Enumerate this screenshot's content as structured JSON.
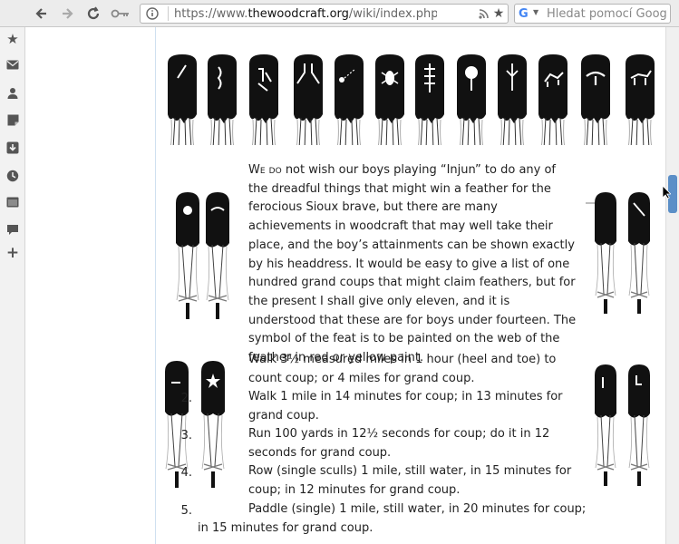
{
  "browser": {
    "url_prefix": "https://www.",
    "url_domain": "thewoodcraft.org",
    "url_suffix": "/wiki/index.php?title=Ladie",
    "search_placeholder": "Hledat pomocí Googl"
  },
  "article": {
    "intro_smallcaps": "We do",
    "intro_rest": " not wish our boys playing “Injun” to do any of the dreadful things that might win a feather for the ferocious Sioux brave, but there are many achievements in woodcraft that may well take their place, and the boy’s attainments can be shown exactly by his headdress. It would be easy to give a list of one hundred grand coups that might claim feathers, but for the present I shall give only eleven, and it is understood that these are for boys under fourteen. The symbol of the feat is to be painted on the web of the feather in red or yellow paint.",
    "items": [
      {
        "num": "",
        "line1": "Walk 3½ measured miles in 1 hour (heel and toe) to",
        "line2": "count coup; or 4 miles for grand coup."
      },
      {
        "num": "2.",
        "line1": "Walk 1 mile in 14 minutes for coup; in 13 minutes for",
        "line2": "grand coup."
      },
      {
        "num": "3.",
        "line1": "Run 100 yards in 12½ seconds for coup; do it in 12",
        "line2": "seconds for grand coup."
      },
      {
        "num": "4.",
        "line1": "Row (single sculls) 1 mile, still water, in 15 minutes for",
        "line2": "coup; in 12 minutes for grand coup."
      },
      {
        "num": "5.",
        "line1": "Paddle (single) 1 mile, still water, in 20 minutes for coup;",
        "line2": "in 15 minutes for grand coup."
      }
    ]
  },
  "icons": {
    "back": "arrow-left-icon",
    "forward": "arrow-right-icon",
    "reload": "reload-icon",
    "key": "key-icon",
    "site_info": "site-info-icon",
    "rss": "rss-icon",
    "bookmark": "star-icon",
    "sidebar": [
      "star-icon",
      "mail-icon",
      "user-icon",
      "note-icon",
      "download-icon",
      "history-icon",
      "window-icon",
      "chat-icon",
      "plus-icon"
    ]
  }
}
